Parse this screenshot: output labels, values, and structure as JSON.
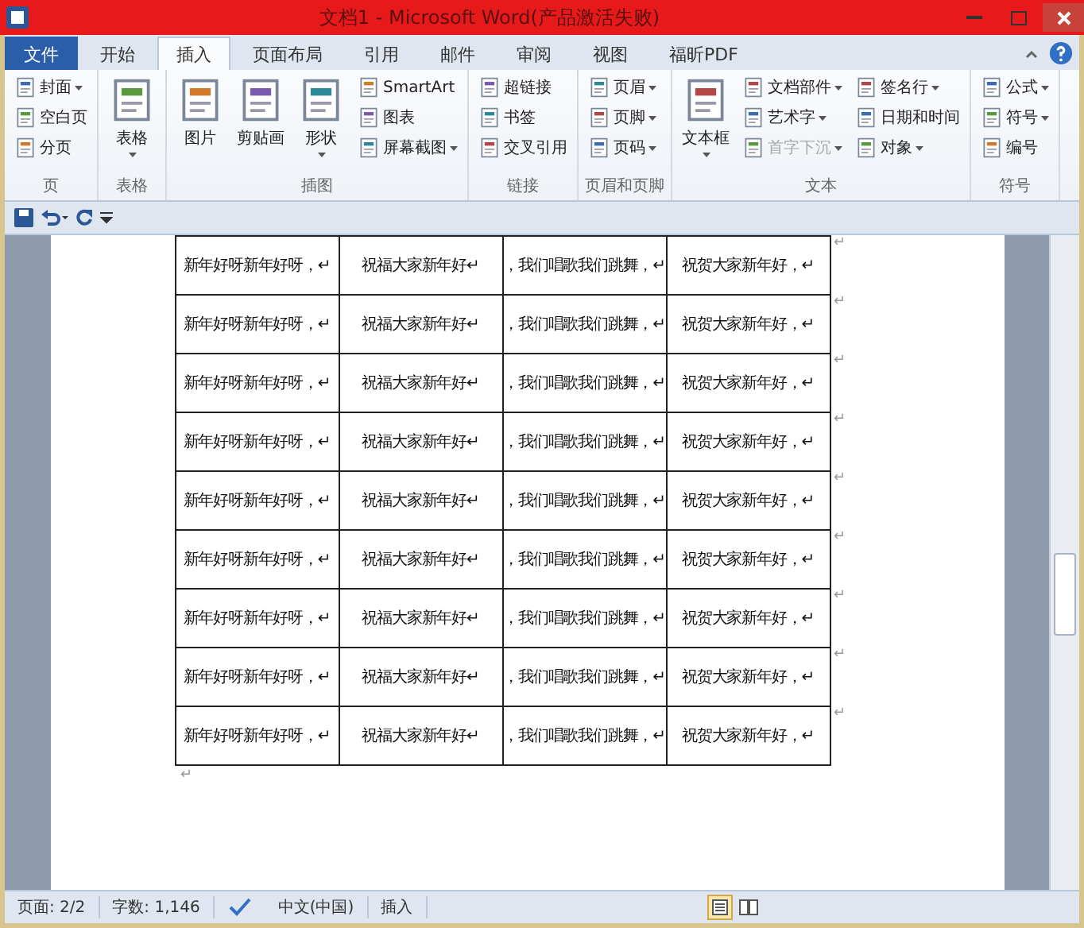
{
  "window": {
    "title": "文档1 - Microsoft Word(产品激活失败)"
  },
  "tabs": [
    {
      "label": "文件",
      "kind": "file",
      "selected": false
    },
    {
      "label": "开始",
      "kind": "tab",
      "selected": false
    },
    {
      "label": "插入",
      "kind": "tab",
      "selected": true
    },
    {
      "label": "页面布局",
      "kind": "tab",
      "selected": false
    },
    {
      "label": "引用",
      "kind": "tab",
      "selected": false
    },
    {
      "label": "邮件",
      "kind": "tab",
      "selected": false
    },
    {
      "label": "审阅",
      "kind": "tab",
      "selected": false
    },
    {
      "label": "视图",
      "kind": "tab",
      "selected": false
    },
    {
      "label": "福昕PDF",
      "kind": "tab",
      "selected": false
    }
  ],
  "ribbon_groups": [
    {
      "label": "页",
      "columns": [
        {
          "kind": "stack",
          "items": [
            {
              "label": "封面",
              "dropdown": true,
              "disabled": false
            },
            {
              "label": "空白页",
              "dropdown": false,
              "disabled": false
            },
            {
              "label": "分页",
              "dropdown": false,
              "disabled": false
            }
          ]
        }
      ]
    },
    {
      "label": "表格",
      "columns": [
        {
          "kind": "large",
          "label": "表格",
          "dropdown": true
        }
      ]
    },
    {
      "label": "插图",
      "columns": [
        {
          "kind": "large",
          "label": "图片",
          "dropdown": false
        },
        {
          "kind": "large",
          "label": "剪贴画",
          "dropdown": false
        },
        {
          "kind": "large",
          "label": "形状",
          "dropdown": true
        },
        {
          "kind": "stack",
          "items": [
            {
              "label": "SmartArt",
              "dropdown": false,
              "disabled": false
            },
            {
              "label": "图表",
              "dropdown": false,
              "disabled": false
            },
            {
              "label": "屏幕截图",
              "dropdown": true,
              "disabled": false
            }
          ]
        }
      ]
    },
    {
      "label": "链接",
      "columns": [
        {
          "kind": "stack",
          "items": [
            {
              "label": "超链接",
              "dropdown": false,
              "disabled": false
            },
            {
              "label": "书签",
              "dropdown": false,
              "disabled": false
            },
            {
              "label": "交叉引用",
              "dropdown": false,
              "disabled": false
            }
          ]
        }
      ]
    },
    {
      "label": "页眉和页脚",
      "columns": [
        {
          "kind": "stack",
          "items": [
            {
              "label": "页眉",
              "dropdown": true,
              "disabled": false
            },
            {
              "label": "页脚",
              "dropdown": true,
              "disabled": false
            },
            {
              "label": "页码",
              "dropdown": true,
              "disabled": false
            }
          ]
        }
      ]
    },
    {
      "label": "文本",
      "columns": [
        {
          "kind": "large",
          "label": "文本框",
          "dropdown": true
        },
        {
          "kind": "stack",
          "items": [
            {
              "label": "文档部件",
              "dropdown": true,
              "disabled": false
            },
            {
              "label": "艺术字",
              "dropdown": true,
              "disabled": false
            },
            {
              "label": "首字下沉",
              "dropdown": true,
              "disabled": true
            }
          ]
        },
        {
          "kind": "stack",
          "items": [
            {
              "label": "签名行",
              "dropdown": true,
              "disabled": false
            },
            {
              "label": "日期和时间",
              "dropdown": false,
              "disabled": false
            },
            {
              "label": "对象",
              "dropdown": true,
              "disabled": false
            }
          ]
        }
      ]
    },
    {
      "label": "符号",
      "columns": [
        {
          "kind": "stack",
          "items": [
            {
              "label": "公式",
              "dropdown": true,
              "disabled": false
            },
            {
              "label": "符号",
              "dropdown": true,
              "disabled": false
            },
            {
              "label": "编号",
              "dropdown": false,
              "disabled": false
            }
          ]
        }
      ]
    }
  ],
  "table": {
    "rows": [
      {
        "cells": [
          "新年好呀新年好呀，↵",
          "祝福大家新年好↵",
          "，我们唱歌我们跳舞，↵",
          "祝贺大家新年好，↵"
        ],
        "end_mark": "↵"
      },
      {
        "cells": [
          "新年好呀新年好呀，↵",
          "祝福大家新年好↵",
          "，我们唱歌我们跳舞，↵",
          "祝贺大家新年好，↵"
        ],
        "end_mark": "↵"
      },
      {
        "cells": [
          "新年好呀新年好呀，↵",
          "祝福大家新年好↵",
          "，我们唱歌我们跳舞，↵",
          "祝贺大家新年好，↵"
        ],
        "end_mark": "↵"
      },
      {
        "cells": [
          "新年好呀新年好呀，↵",
          "祝福大家新年好↵",
          "，我们唱歌我们跳舞，↵",
          "祝贺大家新年好，↵"
        ],
        "end_mark": "↵"
      },
      {
        "cells": [
          "新年好呀新年好呀，↵",
          "祝福大家新年好↵",
          "，我们唱歌我们跳舞，↵",
          "祝贺大家新年好，↵"
        ],
        "end_mark": "↵"
      },
      {
        "cells": [
          "新年好呀新年好呀，↵",
          "祝福大家新年好↵",
          "，我们唱歌我们跳舞，↵",
          "祝贺大家新年好，↵"
        ],
        "end_mark": "↵"
      },
      {
        "cells": [
          "新年好呀新年好呀，↵",
          "祝福大家新年好↵",
          "，我们唱歌我们跳舞，↵",
          "祝贺大家新年好，↵"
        ],
        "end_mark": "↵"
      },
      {
        "cells": [
          "新年好呀新年好呀，↵",
          "祝福大家新年好↵",
          "，我们唱歌我们跳舞，↵",
          "祝贺大家新年好，↵"
        ],
        "end_mark": "↵"
      },
      {
        "cells": [
          "新年好呀新年好呀，↵",
          "祝福大家新年好↵",
          "，我们唱歌我们跳舞，↵",
          "祝贺大家新年好，↵"
        ],
        "end_mark": "↵"
      }
    ],
    "after_mark": "↵"
  },
  "status_bar": {
    "page": "页面: 2/2",
    "words": "字数: 1,146",
    "language": "中文(中国)",
    "mode": "插入"
  }
}
